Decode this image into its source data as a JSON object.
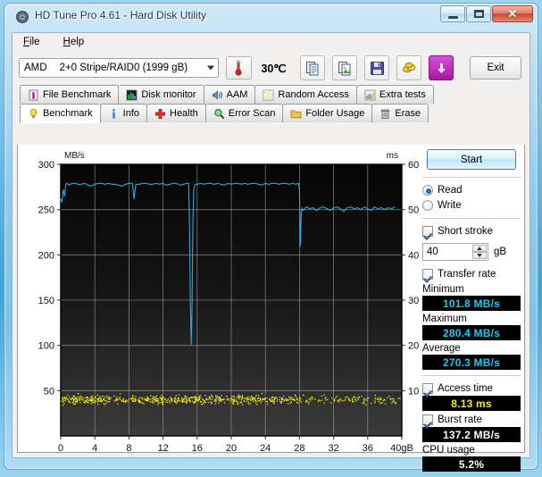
{
  "window": {
    "title": "HD Tune Pro 4.61 - Hard Disk Utility",
    "minimize_label": "Minimize",
    "maximize_label": "Maximize",
    "close_label": "✕"
  },
  "menu": {
    "items": [
      {
        "label": "File",
        "accel": "F"
      },
      {
        "label": "Help",
        "accel": "H"
      }
    ]
  },
  "toolbar": {
    "drive_maker": "AMD",
    "drive_name": "2+0 Stripe/RAID0 (1999 gB)",
    "temperature": "30℃",
    "buttons": [
      {
        "name": "copy-icon",
        "label": "Copy"
      },
      {
        "name": "copy-image-icon",
        "label": "Copy graph"
      },
      {
        "name": "save-icon",
        "label": "Save"
      },
      {
        "name": "options-icon",
        "label": "Options"
      },
      {
        "name": "download-icon",
        "label": "Download"
      }
    ],
    "exit_label": "Exit"
  },
  "tabs": {
    "row1": [
      {
        "label": "File Benchmark",
        "icon": "file-benchmark-icon",
        "active": false
      },
      {
        "label": "Disk monitor",
        "icon": "disk-monitor-icon",
        "active": false
      },
      {
        "label": "AAM",
        "icon": "aam-speaker-icon",
        "active": false
      },
      {
        "label": "Random Access",
        "icon": "random-access-icon",
        "active": false
      },
      {
        "label": "Extra tests",
        "icon": "extra-tests-icon",
        "active": false
      }
    ],
    "row2": [
      {
        "label": "Benchmark",
        "icon": "benchmark-bulb-icon",
        "active": true
      },
      {
        "label": "Info",
        "icon": "info-icon",
        "active": false
      },
      {
        "label": "Health",
        "icon": "health-cross-icon",
        "active": false
      },
      {
        "label": "Error Scan",
        "icon": "error-scan-magnifier-icon",
        "active": false
      },
      {
        "label": "Folder Usage",
        "icon": "folder-usage-icon",
        "active": false
      },
      {
        "label": "Erase",
        "icon": "erase-trash-icon",
        "active": false
      }
    ]
  },
  "sidebar": {
    "start_label": "Start",
    "mode": {
      "read_label": "Read",
      "write_label": "Write",
      "selected": "Read"
    },
    "short_stroke": {
      "label": "Short stroke",
      "checked": true,
      "value": "40",
      "unit": "gB"
    },
    "transfer_rate": {
      "label": "Transfer rate",
      "checked": true
    },
    "minimum": {
      "label": "Minimum",
      "value": "101.8 MB/s"
    },
    "maximum": {
      "label": "Maximum",
      "value": "280.4 MB/s"
    },
    "average": {
      "label": "Average",
      "value": "270.3 MB/s"
    },
    "access_time": {
      "label": "Access time",
      "checked": true,
      "value": "8.13 ms"
    },
    "burst_rate": {
      "label": "Burst rate",
      "checked": true,
      "value": "137.2 MB/s"
    },
    "cpu_usage": {
      "label": "CPU usage",
      "value": "5.2%"
    }
  },
  "colors": {
    "transfer_line": "#2fa8e0",
    "access_dot": "#e8e81a",
    "plot_top": "#060606",
    "plot_bottom": "#3b3b3b",
    "grid": "#9c9c9c",
    "lcd_cyan": "#19c8f0",
    "lcd_yellow": "#f2ec1c"
  },
  "chart_data": {
    "type": "line",
    "title": "",
    "xlabel": "gB",
    "ylabel": "MB/s",
    "y2label": "ms",
    "xlim": [
      0,
      40
    ],
    "ylim": [
      0,
      300
    ],
    "y2lim": [
      0,
      60
    ],
    "xticks": [
      0,
      4,
      8,
      12,
      16,
      20,
      24,
      28,
      32,
      36,
      40
    ],
    "xticklabels": [
      "0",
      "4",
      "8",
      "12",
      "16",
      "20",
      "24",
      "28",
      "32",
      "36",
      "40gB"
    ],
    "yticks": [
      0,
      50,
      100,
      150,
      200,
      250,
      300
    ],
    "yticklabels": [
      "",
      "50",
      "100",
      "150",
      "200",
      "250",
      "300"
    ],
    "y2ticks": [
      0,
      10,
      20,
      30,
      40,
      50,
      60
    ],
    "y2ticklabels": [
      "",
      "10",
      "20",
      "30",
      "40",
      "50",
      "60"
    ],
    "grid": true,
    "legend": "none",
    "series": [
      {
        "name": "Transfer rate",
        "type": "line",
        "color": "#2fa8e0",
        "axis": "left",
        "unit": "MB/s",
        "x": [
          0.0,
          0.15,
          0.3,
          0.45,
          0.6,
          0.8,
          1.0,
          1.3,
          1.6,
          2.0,
          2.4,
          2.8,
          3.2,
          3.6,
          4.0,
          4.4,
          4.8,
          5.2,
          5.6,
          6.0,
          6.4,
          6.8,
          7.2,
          7.6,
          8.0,
          8.4,
          8.6,
          8.8,
          9.2,
          9.6,
          10.0,
          10.4,
          10.8,
          11.2,
          11.6,
          12.0,
          12.4,
          12.8,
          13.2,
          13.6,
          14.0,
          14.4,
          14.8,
          15.0,
          15.1,
          15.2,
          15.3,
          15.4,
          15.5,
          15.6,
          15.7,
          15.8,
          16.0,
          16.4,
          16.8,
          17.2,
          17.6,
          18.0,
          18.4,
          18.8,
          19.2,
          19.6,
          20.0,
          20.4,
          20.8,
          21.2,
          21.6,
          22.0,
          22.4,
          22.8,
          23.2,
          23.6,
          24.0,
          24.4,
          24.8,
          25.2,
          25.6,
          26.0,
          26.4,
          26.8,
          27.2,
          27.6,
          27.9,
          28.0,
          28.1,
          28.2,
          28.3,
          28.4,
          28.6,
          28.8,
          29.2,
          29.6,
          30.0,
          30.4,
          30.8,
          31.2,
          31.6,
          32.0,
          32.4,
          32.8,
          33.2,
          33.6,
          34.0,
          34.4,
          34.8,
          35.2,
          35.6,
          36.0,
          36.4,
          36.8,
          37.2,
          37.6,
          38.0,
          38.4,
          38.8,
          39.2,
          39.6,
          40.0
        ],
        "y": [
          262,
          258,
          272,
          265,
          278,
          279,
          277,
          279,
          279,
          278,
          278,
          279,
          277,
          276,
          278,
          279,
          279,
          278,
          279,
          278,
          278,
          277,
          276,
          278,
          279,
          279,
          262,
          278,
          278,
          279,
          279,
          278,
          278,
          279,
          278,
          279,
          277,
          278,
          279,
          279,
          277,
          278,
          279,
          279,
          235,
          150,
          101,
          140,
          235,
          272,
          276,
          278,
          278,
          279,
          278,
          279,
          279,
          278,
          279,
          278,
          277,
          279,
          278,
          279,
          279,
          278,
          279,
          278,
          279,
          279,
          278,
          277,
          279,
          278,
          279,
          279,
          278,
          279,
          279,
          278,
          279,
          278,
          279,
          270,
          210,
          245,
          252,
          249,
          251,
          253,
          251,
          252,
          249,
          252,
          253,
          251,
          249,
          252,
          253,
          251,
          248,
          252,
          253,
          251,
          252,
          250,
          253,
          251,
          249,
          253,
          251,
          252,
          250,
          252,
          251,
          253
        ],
        "note": "Steady ~278 MB/s to 28 gB, deep spike down to ~101 MB/s near 15.3 gB, then steps to ~251 MB/s"
      },
      {
        "name": "Access time",
        "type": "scatter",
        "color": "#e8e81a",
        "axis": "right",
        "unit": "ms",
        "x_range": [
          0,
          40
        ],
        "y_range": [
          5.5,
          11.5
        ],
        "y_mean": 8.13,
        "point_count": 900,
        "note": "Dense yellow scatter cloud centered near 8 ms, thinning slightly after 28 gB"
      }
    ],
    "summary": {
      "minimum_mb_s": 101.8,
      "maximum_mb_s": 280.4,
      "average_mb_s": 270.3,
      "access_time_ms": 8.13,
      "burst_rate_mb_s": 137.2,
      "cpu_usage_percent": 5.2
    }
  }
}
